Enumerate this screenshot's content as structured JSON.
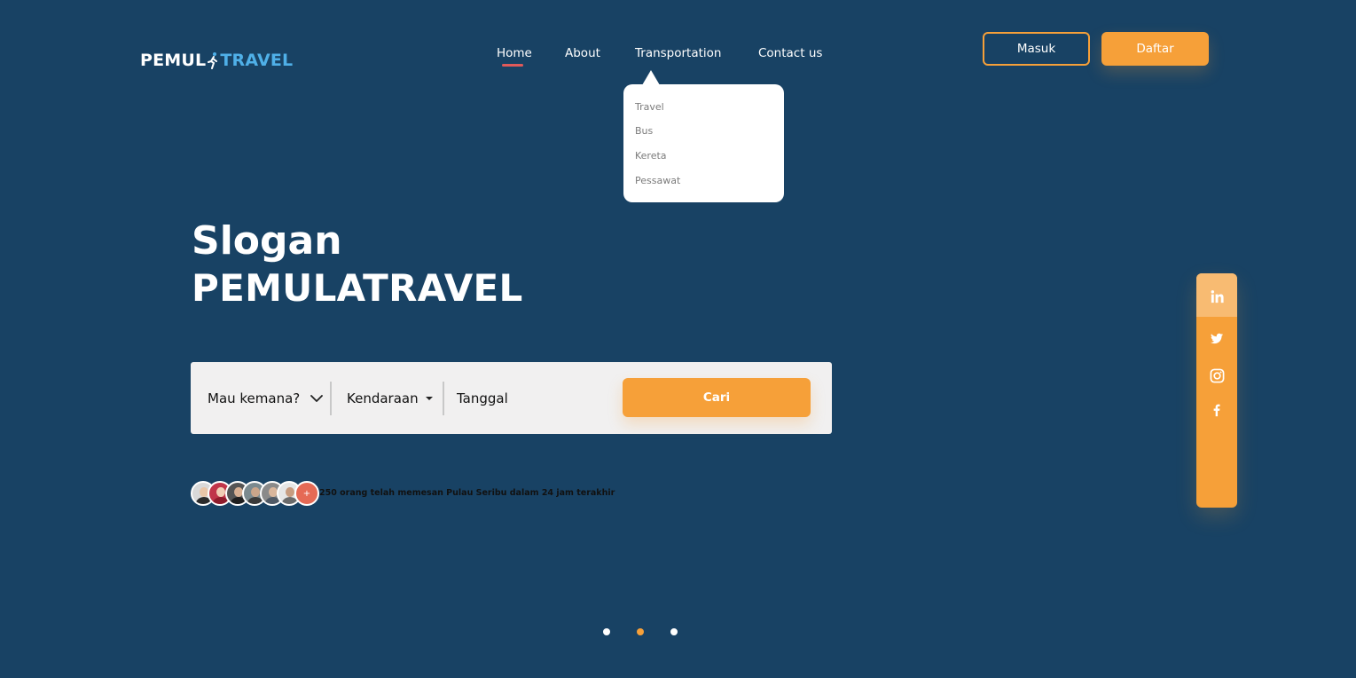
{
  "logo": {
    "part1": "PEMUL",
    "part2": "TRAVEL"
  },
  "nav": {
    "items": [
      {
        "label": "Home",
        "active": true
      },
      {
        "label": "About",
        "active": false
      },
      {
        "label": "Transportation",
        "active": false
      },
      {
        "label": "Contact us",
        "active": false
      }
    ]
  },
  "header": {
    "login_label": "Masuk",
    "register_label": "Daftar"
  },
  "dropdown": {
    "items": [
      "Travel",
      "Bus",
      "Kereta",
      "Pessawat"
    ]
  },
  "hero": {
    "slogan_line1": "Slogan",
    "slogan_line2": "PEMULATRAVEL"
  },
  "search": {
    "destination_placeholder": "Mau kemana?",
    "vehicle_label": "Kendaraan",
    "date_label": "Tanggal",
    "submit_label": "Cari"
  },
  "social_proof": {
    "plus_label": "+",
    "text": "250 orang telah memesan Pulau Seribu dalam 24 jam terakhir"
  },
  "social": {
    "icons": [
      "linkedin-icon",
      "twitter-icon",
      "instagram-icon",
      "facebook-icon"
    ],
    "active": "linkedin-icon"
  },
  "carousel": {
    "count": 3,
    "active_index": 1
  },
  "colors": {
    "background": "#184264",
    "accent": "#f6a039",
    "logo_blue": "#4fb0e8",
    "active_underline": "#e05a5a"
  }
}
